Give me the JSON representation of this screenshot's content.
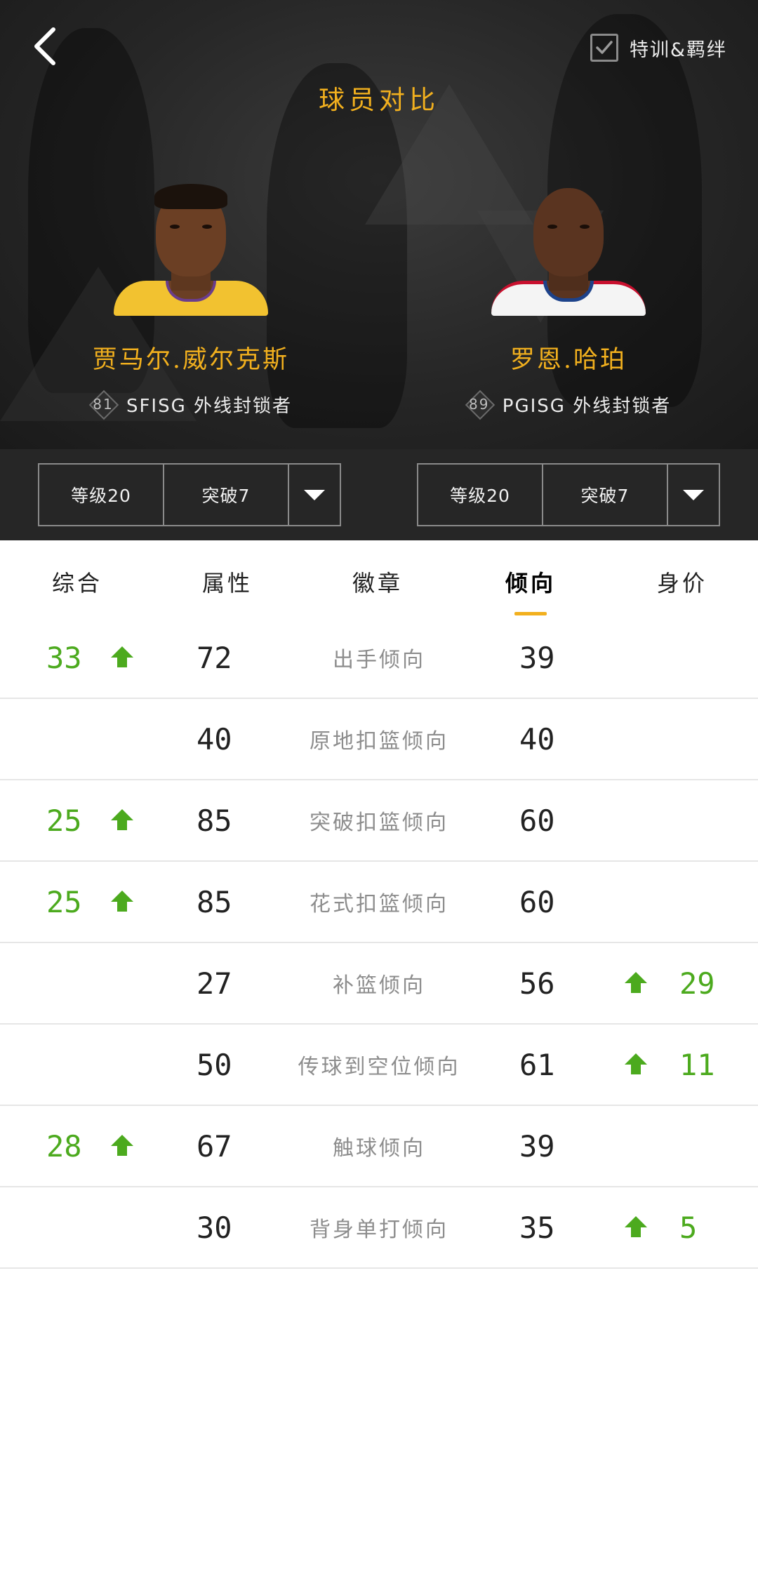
{
  "header": {
    "title": "球员对比",
    "train_toggle": {
      "label": "特训&羁绊",
      "checked": true,
      "icon": "check-icon"
    },
    "back_icon": "chevron-left-icon"
  },
  "players": [
    {
      "name": "贾马尔.威尔克斯",
      "rating": "81",
      "info": "SFISG 外线封锁者",
      "jersey_color": "#f2c230",
      "skin_color": "#6b3f24",
      "selector": {
        "level": "等级20",
        "breakthrough": "突破7"
      }
    },
    {
      "name": "罗恩.哈珀",
      "rating": "89",
      "info": "PGISG 外线封锁者",
      "jersey_color": "#f4f4f4",
      "skin_color": "#5a3420",
      "selector": {
        "level": "等级20",
        "breakthrough": "突破7"
      }
    }
  ],
  "tabs": [
    {
      "label": "综合",
      "active": false
    },
    {
      "label": "属性",
      "active": false
    },
    {
      "label": "徽章",
      "active": false
    },
    {
      "label": "倾向",
      "active": true
    },
    {
      "label": "身价",
      "active": false
    }
  ],
  "rows": [
    {
      "name": "出手倾向",
      "left": "72",
      "right": "39",
      "left_diff": "33",
      "right_diff": ""
    },
    {
      "name": "原地扣篮倾向",
      "left": "40",
      "right": "40",
      "left_diff": "",
      "right_diff": ""
    },
    {
      "name": "突破扣篮倾向",
      "left": "85",
      "right": "60",
      "left_diff": "25",
      "right_diff": ""
    },
    {
      "name": "花式扣篮倾向",
      "left": "85",
      "right": "60",
      "left_diff": "25",
      "right_diff": ""
    },
    {
      "name": "补篮倾向",
      "left": "27",
      "right": "56",
      "left_diff": "",
      "right_diff": "29"
    },
    {
      "name": "传球到空位倾向",
      "left": "50",
      "right": "61",
      "left_diff": "",
      "right_diff": "11"
    },
    {
      "name": "触球倾向",
      "left": "67",
      "right": "39",
      "left_diff": "28",
      "right_diff": ""
    },
    {
      "name": "背身单打倾向",
      "left": "30",
      "right": "35",
      "left_diff": "",
      "right_diff": "5"
    }
  ],
  "colors": {
    "accent": "#f2b01e",
    "increase": "#4caa1e",
    "header_bg": "#262626"
  }
}
